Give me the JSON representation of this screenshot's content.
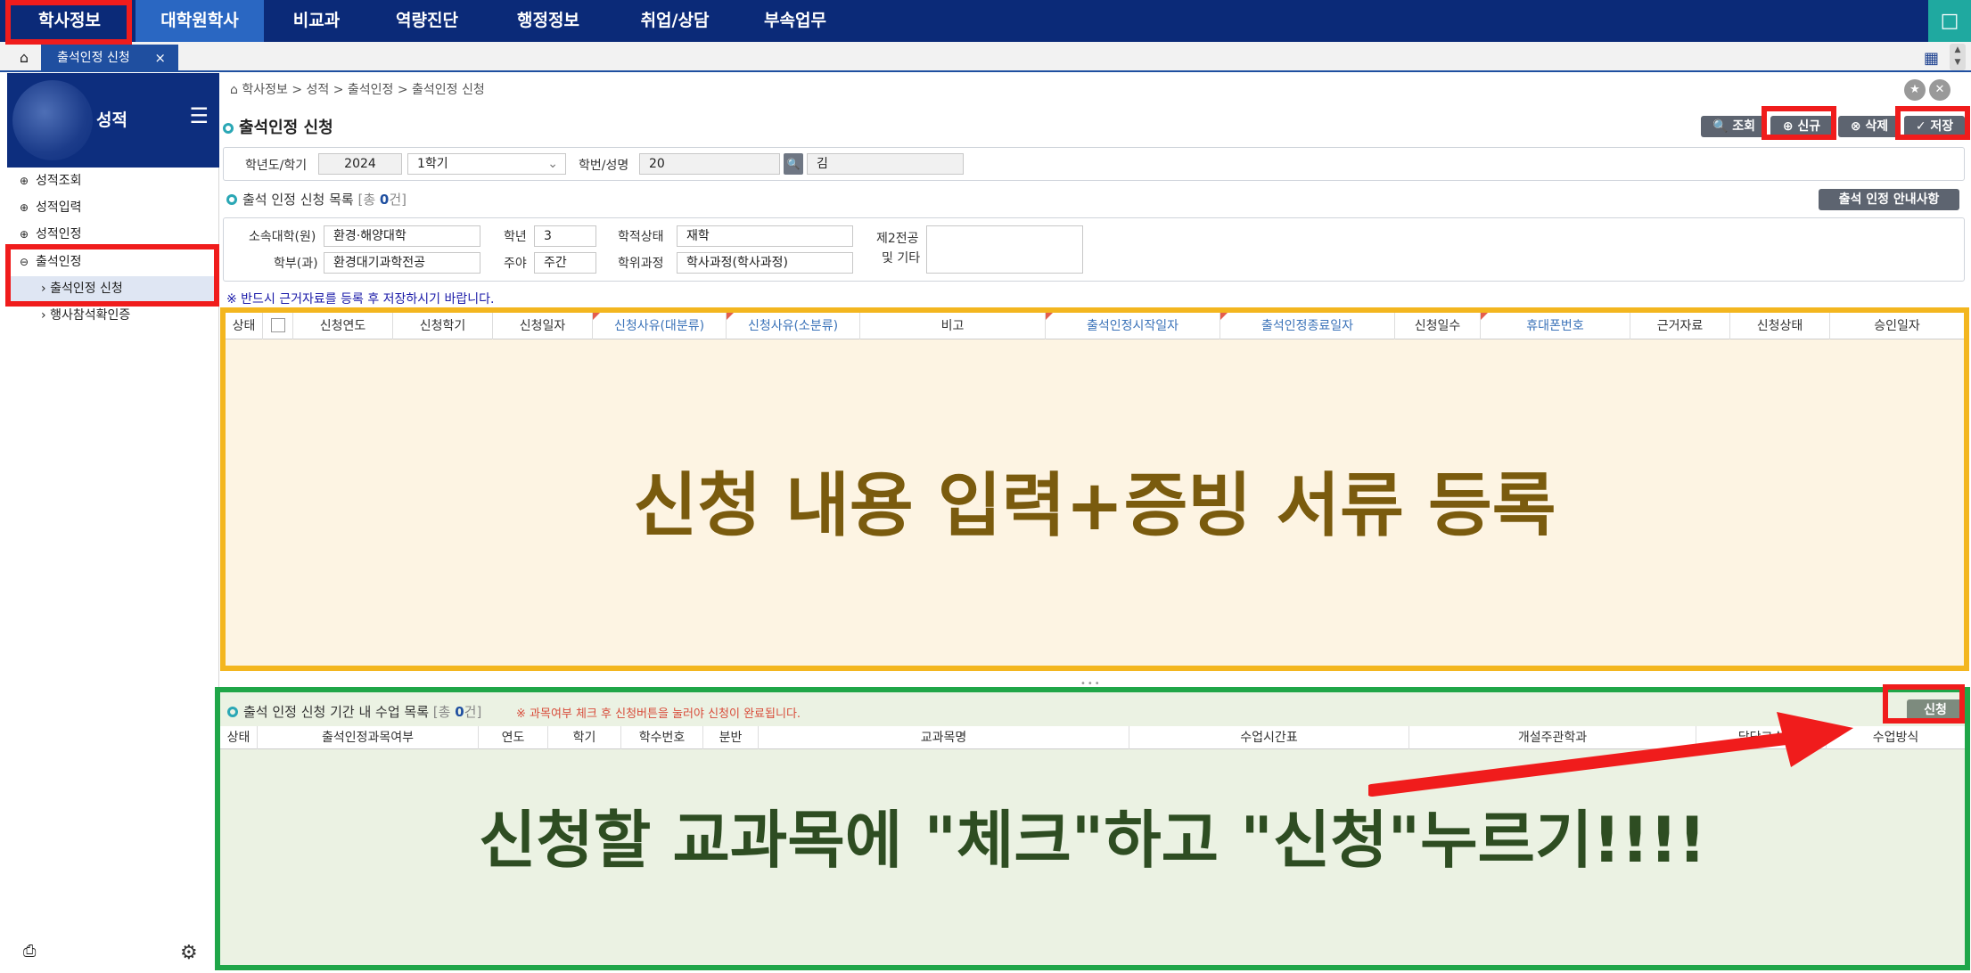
{
  "nav": {
    "items": [
      "학사정보",
      "대학원학사",
      "비교과",
      "역량진단",
      "행정정보",
      "취업/상담",
      "부속업무"
    ],
    "active_index": 1,
    "bookmark_icon": "bookmark-icon"
  },
  "tabs": {
    "home_icon": "home-icon",
    "open_tab": "출석인정 신청",
    "close_glyph": "×"
  },
  "sidebar": {
    "title": "성적",
    "items": [
      {
        "label": "성적조회",
        "bullet": "⊕"
      },
      {
        "label": "성적입력",
        "bullet": "⊕"
      },
      {
        "label": "성적인정",
        "bullet": "⊕"
      },
      {
        "label": "출석인정",
        "bullet": "⊖"
      }
    ],
    "subitems": [
      "출석인정 신청",
      "행사참석확인증"
    ]
  },
  "breadcrumb": "학사정보 > 성적 > 출석인정 > 출석인정 신청",
  "page_title": "출석인정 신청",
  "toolbar": {
    "search": "조회",
    "new": "신규",
    "delete": "삭제",
    "save": "저장"
  },
  "search": {
    "year_term_label": "학년도/학기",
    "year": "2024",
    "term": "1학기",
    "student_label": "학번/성명",
    "student_id": "20",
    "student_name": "김"
  },
  "list": {
    "title": "출석 인정 신청 목록",
    "count_prefix": "[총 ",
    "count": "0",
    "count_suffix": "건]"
  },
  "guide_button": "출석 인정 안내사항",
  "info": {
    "college_label": "소속대학(원)",
    "college": "환경·해양대학",
    "year_label": "학년",
    "year": "3",
    "status_label": "학적상태",
    "status": "재학",
    "major2_label_1": "제2전공",
    "major2_label_2": "및 기타",
    "major2": "",
    "dept_label": "학부(과)",
    "dept": "환경대기과학전공",
    "daynight_label": "주야",
    "daynight": "주간",
    "degree_label": "학위과정",
    "degree": "학사과정(학사과정)"
  },
  "notice": "※ 반드시 근거자료를 등록 후 저장하시기 바랍니다.",
  "upper_grid": {
    "columns": [
      "상태",
      "",
      "신청연도",
      "신청학기",
      "신청일자",
      "신청사유(대분류)",
      "신청사유(소분류)",
      "비고",
      "출석인정시작일자",
      "출석인정종료일자",
      "신청일수",
      "휴대폰번호",
      "근거자료",
      "신청상태",
      "승인일자"
    ],
    "overlay": "신청 내용 입력+증빙 서류 등록"
  },
  "lower_grid": {
    "title": "출석 인정 신청 기간 내 수업 목록",
    "count_prefix": "[총 ",
    "count": "0",
    "count_suffix": "건]",
    "warning": "※ 과목여부 체크 후 신청버튼을 눌러야 신청이 완료됩니다.",
    "apply_button": "신청",
    "columns": [
      "상태",
      "출석인정과목여부",
      "연도",
      "학기",
      "학수번호",
      "분반",
      "교과목명",
      "수업시간표",
      "개설주관학과",
      "담당교수",
      "수업방식"
    ],
    "overlay": "신청할 교과목에 \"체크\"하고 \"신청\"누르기!!!!"
  },
  "colors": {
    "nav_bg": "#0b2a78",
    "upper_highlight": "#f3b61f",
    "lower_highlight": "#1fa648",
    "annotation_red": "#f01c1c",
    "upper_text": "#7a5b0e",
    "lower_text": "#2e4d22"
  }
}
